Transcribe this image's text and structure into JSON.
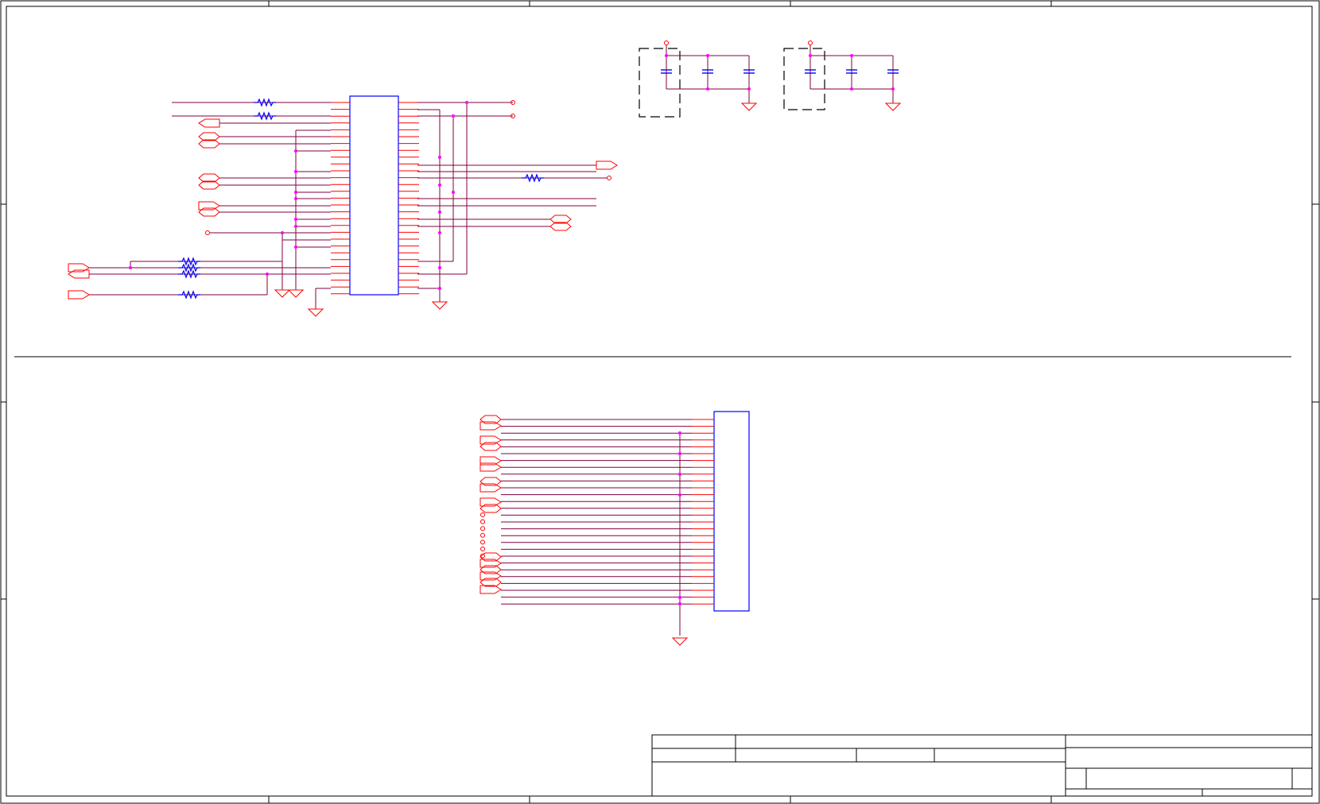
{
  "colors": {
    "frame": "#000000",
    "wire_red": "#ff0000",
    "wire_dark": "#800040",
    "body_blue": "#0000ff",
    "resistor_blue": "#0000ff",
    "junction": "#ff00ff",
    "ground": "#ff0000"
  },
  "sheet": {
    "columns": 5,
    "rows": 4
  },
  "title_block": {
    "title": "",
    "sheet_number": "",
    "revision": "",
    "date": ""
  }
}
